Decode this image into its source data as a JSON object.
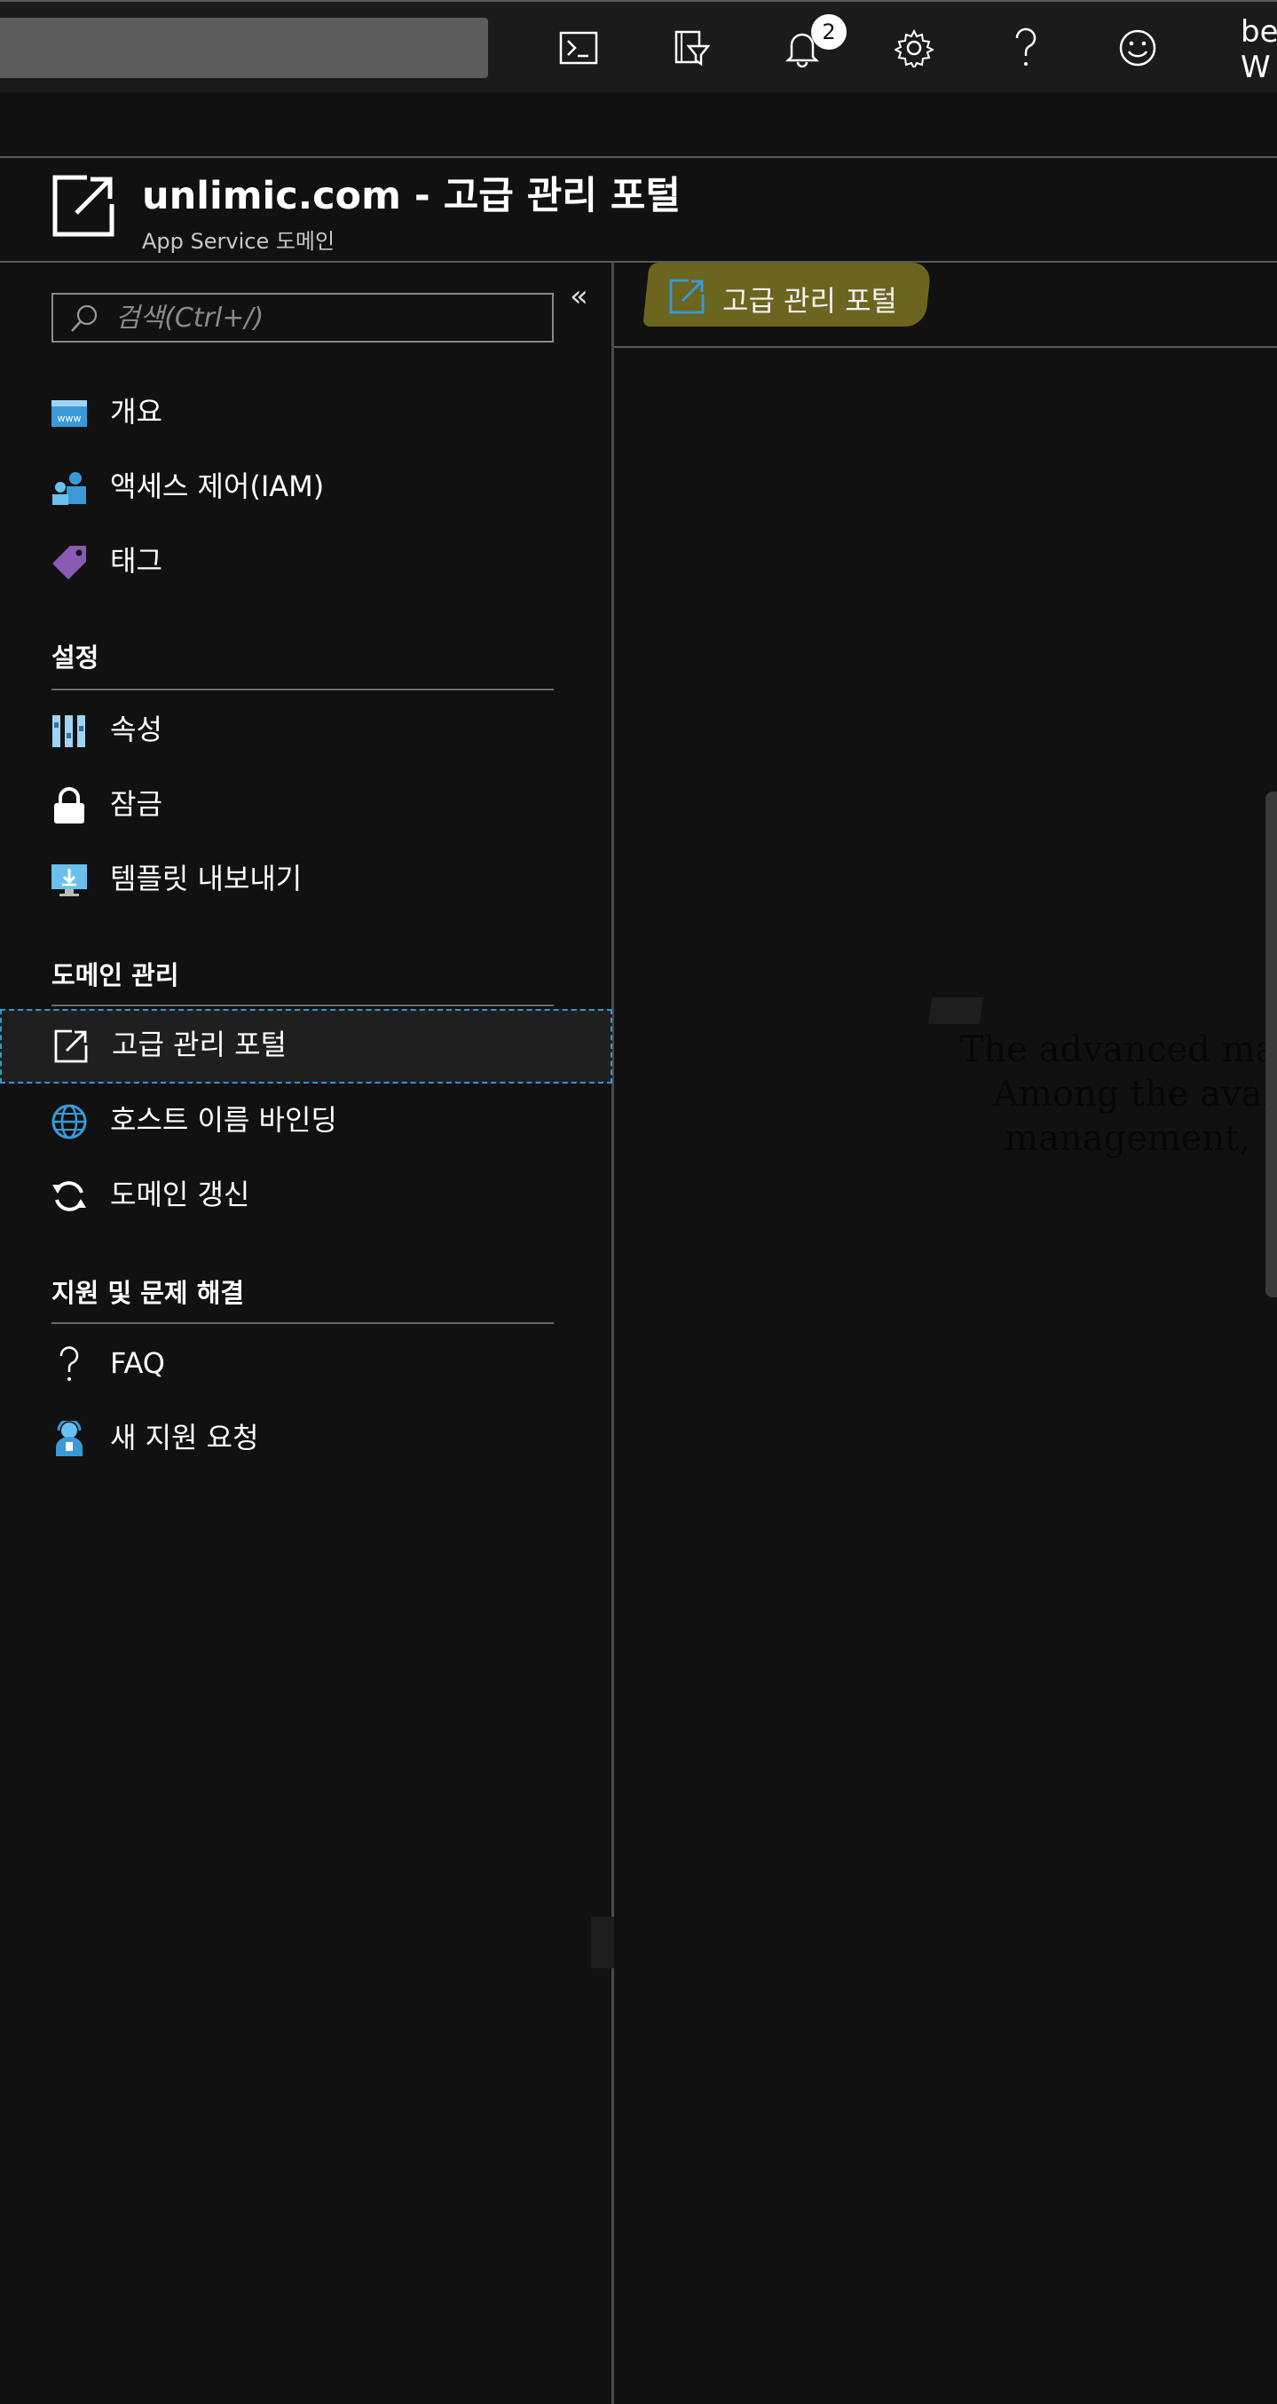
{
  "topbar": {
    "notifications_count": "2",
    "user_name": "be\nW",
    "icons": [
      "cloud-shell-icon",
      "directory-filter-icon",
      "bell-icon",
      "settings-gear-icon",
      "help-question-icon",
      "feedback-smiley-icon"
    ]
  },
  "page": {
    "title": "unlimic.com - 고급 관리 포털",
    "subtitle": "App Service 도메인"
  },
  "menu": {
    "search_placeholder": "검색(Ctrl+/)",
    "collapse_glyph": "«",
    "items_top": [
      {
        "label": "개요",
        "icon": "www-overview-icon"
      },
      {
        "label": "액세스 제어(IAM)",
        "icon": "people-iam-icon"
      },
      {
        "label": "태그",
        "icon": "tag-icon"
      }
    ],
    "section_settings": "설정",
    "items_settings": [
      {
        "label": "속성",
        "icon": "properties-bars-icon"
      },
      {
        "label": "잠금",
        "icon": "lock-icon"
      },
      {
        "label": "템플릿 내보내기",
        "icon": "export-template-icon"
      }
    ],
    "section_domain": "도메인 관리",
    "items_domain": [
      {
        "label": "고급 관리 포털",
        "icon": "external-link-icon",
        "active": true
      },
      {
        "label": "호스트 이름 바인딩",
        "icon": "globe-icon"
      },
      {
        "label": "도메인 갱신",
        "icon": "refresh-icon"
      }
    ],
    "section_support": "지원 및 문제 해결",
    "items_support": [
      {
        "label": "FAQ",
        "icon": "question-icon"
      },
      {
        "label": "새 지원 요청",
        "icon": "support-person-icon"
      }
    ]
  },
  "content": {
    "toolbar_button": "고급 관리 포털",
    "message_lines": [
      "The advanced management p",
      "Among the available fea",
      "management,"
    ]
  },
  "colors": {
    "background": "#111112",
    "topbar": "#1b1b1c",
    "active_border": "#2b9ad4",
    "highlight": "#6b6520",
    "icon_blue": "#3a9ad8",
    "icon_purple": "#8a5bb5"
  }
}
